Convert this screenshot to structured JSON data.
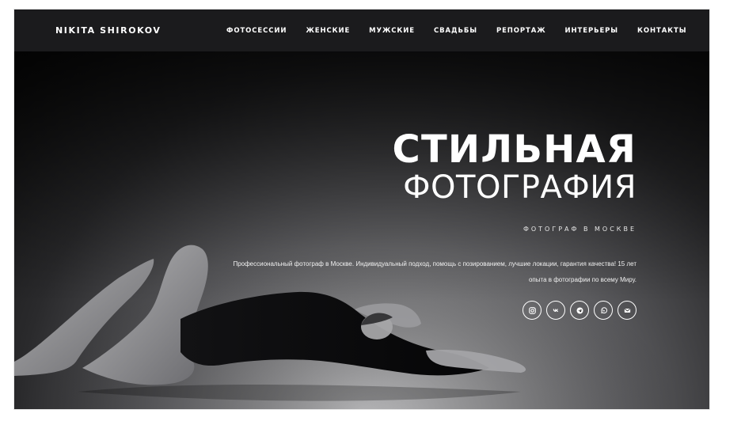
{
  "brand": {
    "name": "NIKITA SHIROKOV"
  },
  "nav": {
    "items": [
      {
        "label": "ФОТОСЕССИИ"
      },
      {
        "label": "ЖЕНСКИЕ"
      },
      {
        "label": "МУЖСКИЕ"
      },
      {
        "label": "СВАДЬБЫ"
      },
      {
        "label": "РЕПОРТАЖ"
      },
      {
        "label": "ИНТЕРЬЕРЫ"
      },
      {
        "label": "КОНТАКТЫ"
      }
    ]
  },
  "hero": {
    "title_line1": "СТИЛЬНАЯ",
    "title_line2": "ФОТОГРАФИЯ",
    "subtitle": "ФОТОГРАФ В МОСКВЕ",
    "description": "Профессиональный фотограф в Москве. Индивидуальный подход, помощь с позированием, лучшие локации, гарантия качества! 15 лет опыта в фотографии по всему Миру."
  },
  "socials": [
    {
      "icon": "instagram-icon"
    },
    {
      "icon": "vk-icon"
    },
    {
      "icon": "telegram-icon"
    },
    {
      "icon": "whatsapp-icon"
    },
    {
      "icon": "email-icon"
    }
  ],
  "colors": {
    "topbar_bg": "#1b1b1d",
    "text": "#ffffff"
  }
}
